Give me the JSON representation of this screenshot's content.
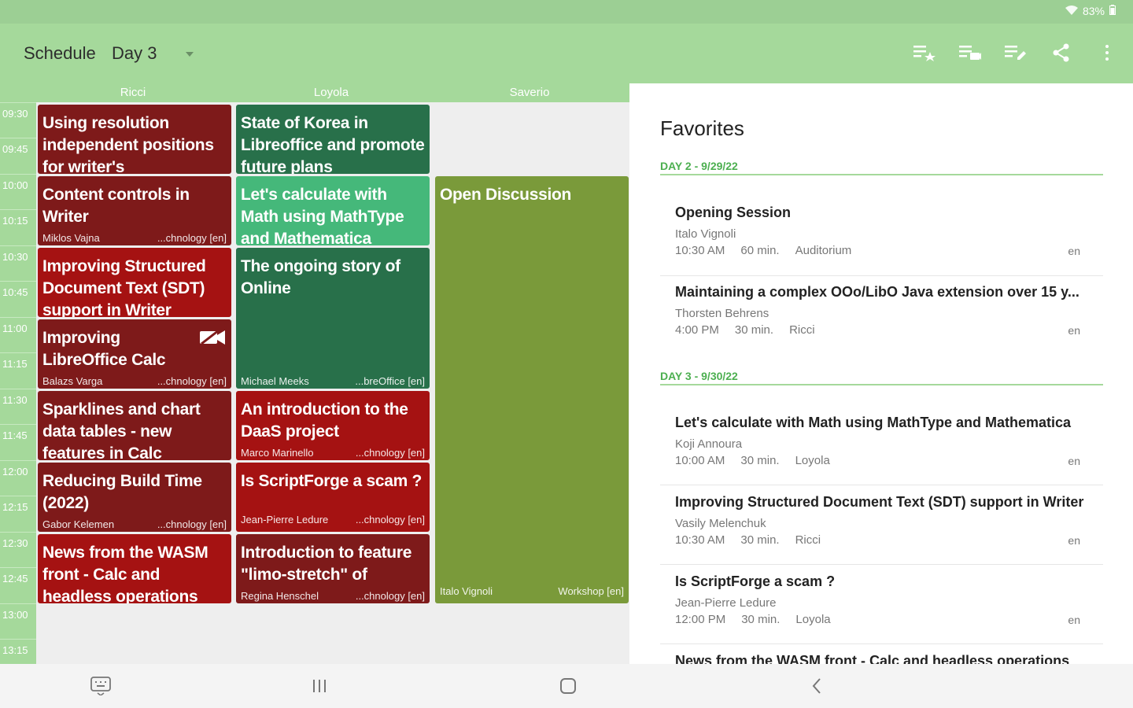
{
  "status": {
    "battery": "83%"
  },
  "appbar": {
    "title": "Schedule",
    "day": "Day 3"
  },
  "icons": {
    "wifi": "wifi-icon",
    "battery": "battery-icon",
    "dropdown": "chevron-down-icon",
    "starred": "playlist-star-icon",
    "playlist": "playlist-icon",
    "playlist_edit": "playlist-edit-icon",
    "share": "share-icon",
    "more": "more-vert-icon"
  },
  "rooms": [
    "Ricci",
    "Loyola",
    "Saverio"
  ],
  "times": [
    "09:30",
    "09:45",
    "10:00",
    "10:15",
    "10:30",
    "10:45",
    "11:00",
    "11:15",
    "11:30",
    "11:45",
    "12:00",
    "12:15",
    "12:30",
    "12:45",
    "13:00",
    "13:15"
  ],
  "colors": {
    "dark_red": "#7e1a1a",
    "bright_red": "#a51212",
    "dark_green": "#28704a",
    "light_green": "#45b87a",
    "olive": "#7a9a3a",
    "app_green": "#a5d99b"
  },
  "sessions": [
    {
      "title": "Using resolution independent positions for writer's",
      "speaker": "",
      "track": ""
    },
    {
      "title": "Content controls in Writer",
      "speaker": "Miklos Vajna",
      "track": "...chnology [en]"
    },
    {
      "title": "Improving Structured Document Text (SDT) support in Writer",
      "speaker": "",
      "track": ""
    },
    {
      "title": "Improving LibreOffice Calc",
      "speaker": "Balazs Varga",
      "track": "...chnology [en]"
    },
    {
      "title": "Sparklines and chart data tables - new features in Calc",
      "speaker": "",
      "track": ""
    },
    {
      "title": "Reducing Build Time (2022)",
      "speaker": "Gabor Kelemen",
      "track": "...chnology [en]"
    },
    {
      "title": "News from the WASM front - Calc and headless operations",
      "speaker": "",
      "track": ""
    },
    {
      "title": "State of Korea in Libreoffice and promote future plans",
      "speaker": "",
      "track": ""
    },
    {
      "title": "Let's calculate with Math using MathType and Mathematica",
      "speaker": "",
      "track": ""
    },
    {
      "title": "The ongoing story of Online",
      "speaker": "Michael Meeks",
      "track": "...breOffice [en]"
    },
    {
      "title": "An introduction to the DaaS project",
      "speaker": "Marco Marinello",
      "track": "...chnology [en]"
    },
    {
      "title": "Is ScriptForge a scam ?",
      "speaker": "Jean-Pierre Ledure",
      "track": "...chnology [en]"
    },
    {
      "title": "Introduction to feature \"limo-stretch\" of shapes",
      "speaker": "Regina Henschel",
      "track": "...chnology [en]"
    },
    {
      "title": "Open Discussion",
      "speaker": "Italo Vignoli",
      "track": "Workshop [en]"
    }
  ],
  "favorites": {
    "title": "Favorites",
    "days": [
      {
        "label": "DAY 2 - 9/29/22",
        "items": [
          {
            "title": "Opening Session",
            "speaker": "Italo Vignoli",
            "time": "10:30 AM",
            "duration": "60 min.",
            "room": "Auditorium",
            "lang": "en"
          },
          {
            "title": "Maintaining a complex OOo/LibO Java extension over 15 y...",
            "speaker": "Thorsten Behrens",
            "time": "4:00 PM",
            "duration": "30 min.",
            "room": "Ricci",
            "lang": "en"
          }
        ]
      },
      {
        "label": "DAY 3 - 9/30/22",
        "items": [
          {
            "title": "Let's calculate with Math using MathType and Mathematica",
            "speaker": "Koji Annoura",
            "time": "10:00 AM",
            "duration": "30 min.",
            "room": "Loyola",
            "lang": "en"
          },
          {
            "title": "Improving Structured Document Text (SDT) support in Writer",
            "speaker": "Vasily Melenchuk",
            "time": "10:30 AM",
            "duration": "30 min.",
            "room": "Ricci",
            "lang": "en"
          },
          {
            "title": "Is ScriptForge a scam ?",
            "speaker": "Jean-Pierre Ledure",
            "time": "12:00 PM",
            "duration": "30 min.",
            "room": "Loyola",
            "lang": "en"
          },
          {
            "title": "News from the WASM front - Calc and headless operations",
            "speaker": "",
            "time": "",
            "duration": "",
            "room": "",
            "lang": ""
          }
        ]
      }
    ]
  },
  "nav": {
    "keyboard": "keyboard-icon",
    "recents": "recents-icon",
    "home": "home-icon",
    "back": "back-icon"
  }
}
